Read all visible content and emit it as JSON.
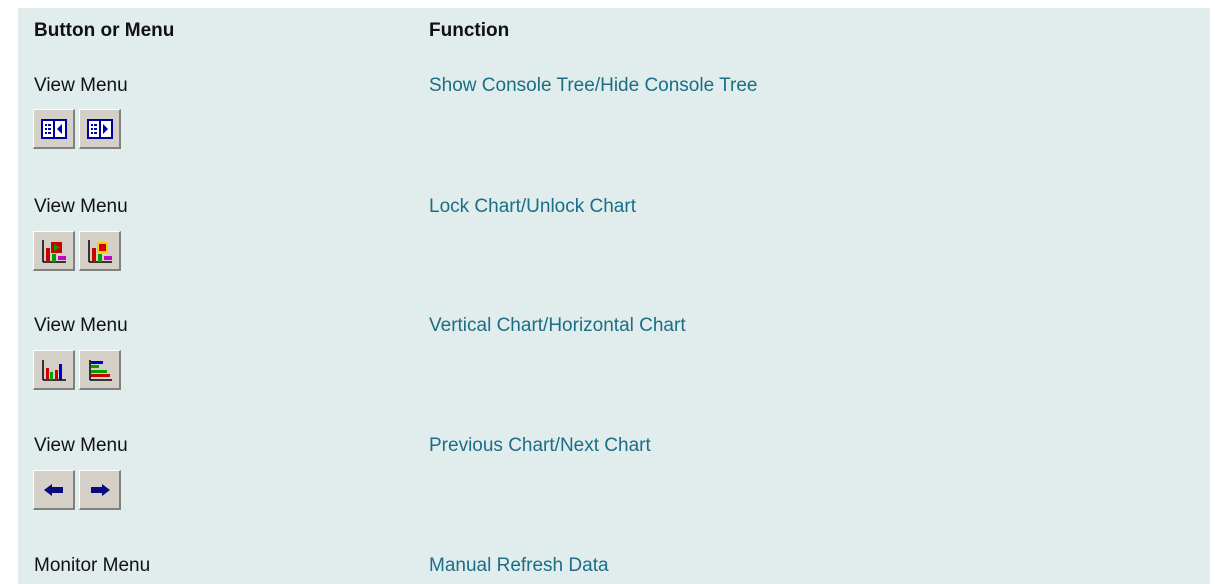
{
  "table": {
    "header": {
      "button_col": "Button or Menu",
      "function_col": "Function"
    },
    "rows": [
      {
        "menu": "View Menu",
        "function": "Show Console Tree/Hide Console Tree",
        "icons": [
          "show-console-tree-icon",
          "hide-console-tree-icon"
        ]
      },
      {
        "menu": "View Menu",
        "function": "Lock Chart/Unlock Chart",
        "icons": [
          "lock-chart-icon",
          "unlock-chart-icon"
        ]
      },
      {
        "menu": "View Menu",
        "function": "Vertical Chart/Horizontal Chart",
        "icons": [
          "vertical-chart-icon",
          "horizontal-chart-icon"
        ]
      },
      {
        "menu": "View Menu",
        "function": "Previous Chart/Next Chart",
        "icons": [
          "previous-arrow-icon",
          "next-arrow-icon"
        ]
      },
      {
        "menu": "Monitor Menu",
        "function": "Manual Refresh Data",
        "icons": []
      }
    ]
  },
  "colors": {
    "background": "#e1ecec",
    "link": "#1a6e86",
    "text": "#111111",
    "button_face": "#d4d0c8"
  }
}
